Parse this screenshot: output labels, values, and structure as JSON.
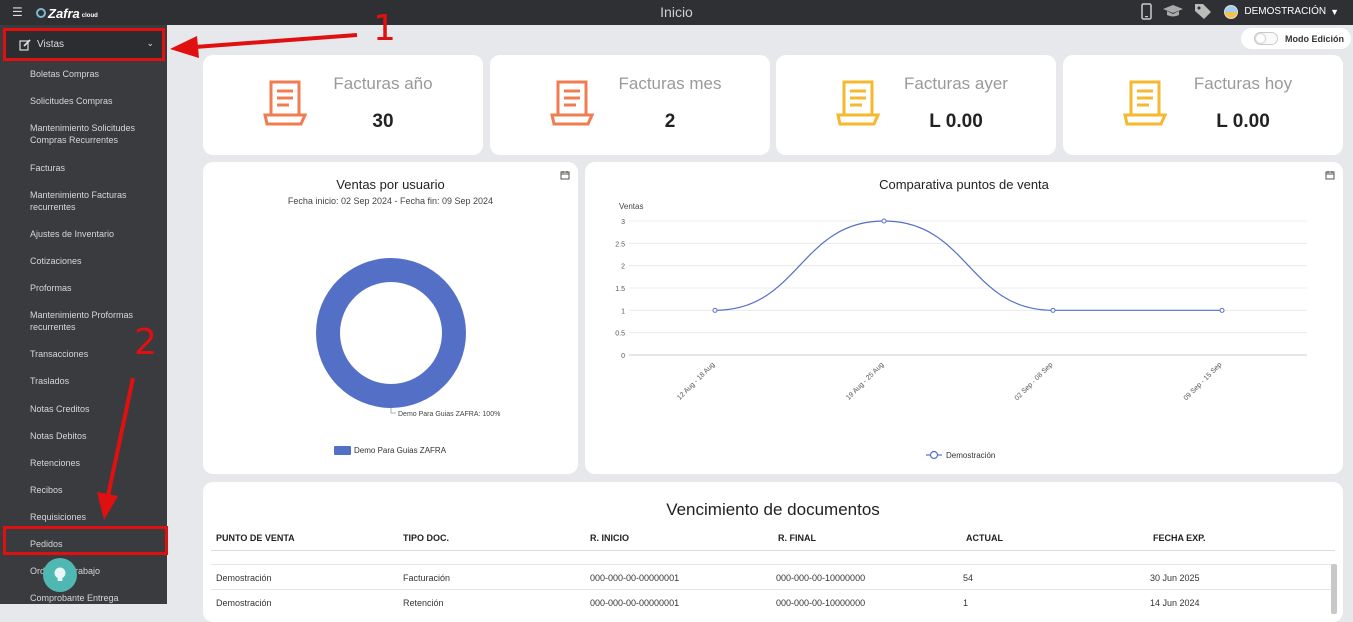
{
  "topbar": {
    "title": "Inicio",
    "brand": "Zafra",
    "brand_tld": "cloud",
    "user": "DEMOSTRACIÓN"
  },
  "sidebar": {
    "section_label": "Vistas",
    "items": [
      {
        "label": "Boletas Compras"
      },
      {
        "label": "Solicitudes Compras"
      },
      {
        "label": "Mantenimiento Solicitudes Compras Recurrentes"
      },
      {
        "label": "Facturas"
      },
      {
        "label": "Mantenimiento Facturas recurrentes"
      },
      {
        "label": "Ajustes de Inventario"
      },
      {
        "label": "Cotizaciones"
      },
      {
        "label": "Proformas"
      },
      {
        "label": "Mantenimiento Proformas recurrentes"
      },
      {
        "label": "Transacciones"
      },
      {
        "label": "Traslados"
      },
      {
        "label": "Notas Creditos"
      },
      {
        "label": "Notas Debitos"
      },
      {
        "label": "Retenciones"
      },
      {
        "label": "Recibos"
      },
      {
        "label": "Requisiciones"
      },
      {
        "label": "Pedidos"
      },
      {
        "label": "Orden de Trabajo"
      },
      {
        "label": "Comprobante Entrega"
      }
    ]
  },
  "annotations": {
    "step1": "1",
    "step2": "2"
  },
  "edit_mode": {
    "label": "Modo Edición",
    "on": false
  },
  "stats": [
    {
      "title": "Facturas año",
      "value": "30",
      "color": "#f07c52"
    },
    {
      "title": "Facturas mes",
      "value": "2",
      "color": "#f07c52"
    },
    {
      "title": "Facturas ayer",
      "value": "L 0.00",
      "color": "#f5b82e"
    },
    {
      "title": "Facturas hoy",
      "value": "L 0.00",
      "color": "#f5b82e"
    }
  ],
  "chart_data": [
    {
      "type": "pie",
      "title": "Ventas por usuario",
      "subtitle": "Fecha inicio: 02 Sep 2024 - Fecha fin: 09 Sep 2024",
      "categories": [
        "Demo Para Guias ZAFRA"
      ],
      "values": [
        100
      ],
      "slice_label": "Demo Para Guias ZAFRA: 100%",
      "legend": [
        "Demo Para Guias ZAFRA"
      ],
      "legend_position": "bottom",
      "color": "#5470c6"
    },
    {
      "type": "line",
      "title": "Comparativa puntos de venta",
      "ylabel": "Ventas",
      "categories": [
        "12 Aug - 18 Aug",
        "19 Aug - 25 Aug",
        "02 Sep - 08 Sep",
        "09 Sep - 15 Sep"
      ],
      "series": [
        {
          "name": "Demostración",
          "values": [
            1,
            3,
            1,
            1
          ]
        }
      ],
      "ylim": [
        0,
        3
      ],
      "yticks": [
        "0",
        "0.5",
        "1",
        "1.5",
        "2",
        "2.5",
        "3"
      ],
      "grid": true,
      "legend_position": "bottom",
      "color": "#5470c6"
    }
  ],
  "expirations": {
    "title": "Vencimiento de documentos",
    "headers": [
      "PUNTO DE VENTA",
      "TIPO DOC.",
      "R. INICIO",
      "R. FINAL",
      "ACTUAL",
      "FECHA EXP."
    ],
    "rows": [
      [
        "Demostración",
        "Facturación",
        "000-000-00-00000001",
        "000-000-00-10000000",
        "54",
        "30 Jun 2025"
      ],
      [
        "Demostración",
        "Retención",
        "000-000-00-00000001",
        "000-000-00-10000000",
        "1",
        "14 Jun 2024"
      ]
    ]
  }
}
